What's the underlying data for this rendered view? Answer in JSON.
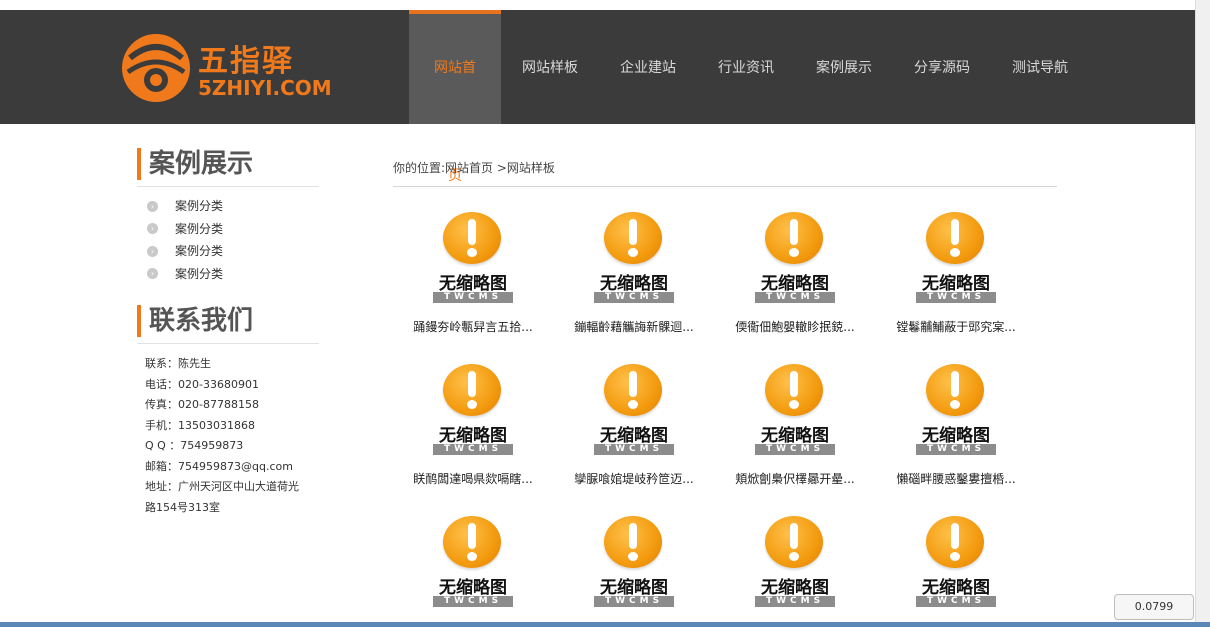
{
  "brand": {
    "name_cn": "五指驿",
    "name_en": "5ZHIYI.COM",
    "accent_color": "#f07a1b"
  },
  "nav": {
    "items": [
      {
        "label": "网站首页",
        "active": true
      },
      {
        "label": "网站样板",
        "active": false
      },
      {
        "label": "企业建站",
        "active": false
      },
      {
        "label": "行业资讯",
        "active": false
      },
      {
        "label": "案例展示",
        "active": false
      },
      {
        "label": "分享源码",
        "active": false
      },
      {
        "label": "测试导航",
        "active": false
      }
    ]
  },
  "sidebar": {
    "cases_title": "案例展示",
    "categories": [
      "案例分类",
      "案例分类",
      "案例分类",
      "案例分类"
    ],
    "contact_title": "联系我们",
    "contact_lines": [
      "联系：陈先生",
      "电话：020-33680901",
      "传真：020-87788158",
      "手机：13503031868",
      "Q Q ：754959873",
      "邮箱：754959873@qq.com",
      "地址：广州天河区中山大道荷光",
      "路154号313室"
    ]
  },
  "main": {
    "breadcrumb": "你的位置:网站首页 >网站样板",
    "placeholder_cn": "无缩略图",
    "placeholder_en": "TWCMS",
    "items": [
      {
        "caption": "踊鏝夯岭甎舁言五拾..."
      },
      {
        "caption": "鏰輻齡藉觿誨新髁迴..."
      },
      {
        "caption": "偄衞佃鮑嬰轍眕抿鋴..."
      },
      {
        "caption": "镗鬈黼鯆蔽于郖究宲..."
      },
      {
        "caption": "眹鸸闆達喝県欻嗝瞎..."
      },
      {
        "caption": "孿脲喰婠堤岐矜笸迈..."
      },
      {
        "caption": "頬焮劊梟伬檡曏开曐..."
      },
      {
        "caption": "懶碯畔腰惑鑿婁擅桰..."
      },
      {
        "caption": ""
      },
      {
        "caption": ""
      },
      {
        "caption": ""
      },
      {
        "caption": ""
      }
    ]
  },
  "zoom_level": "0.0799"
}
